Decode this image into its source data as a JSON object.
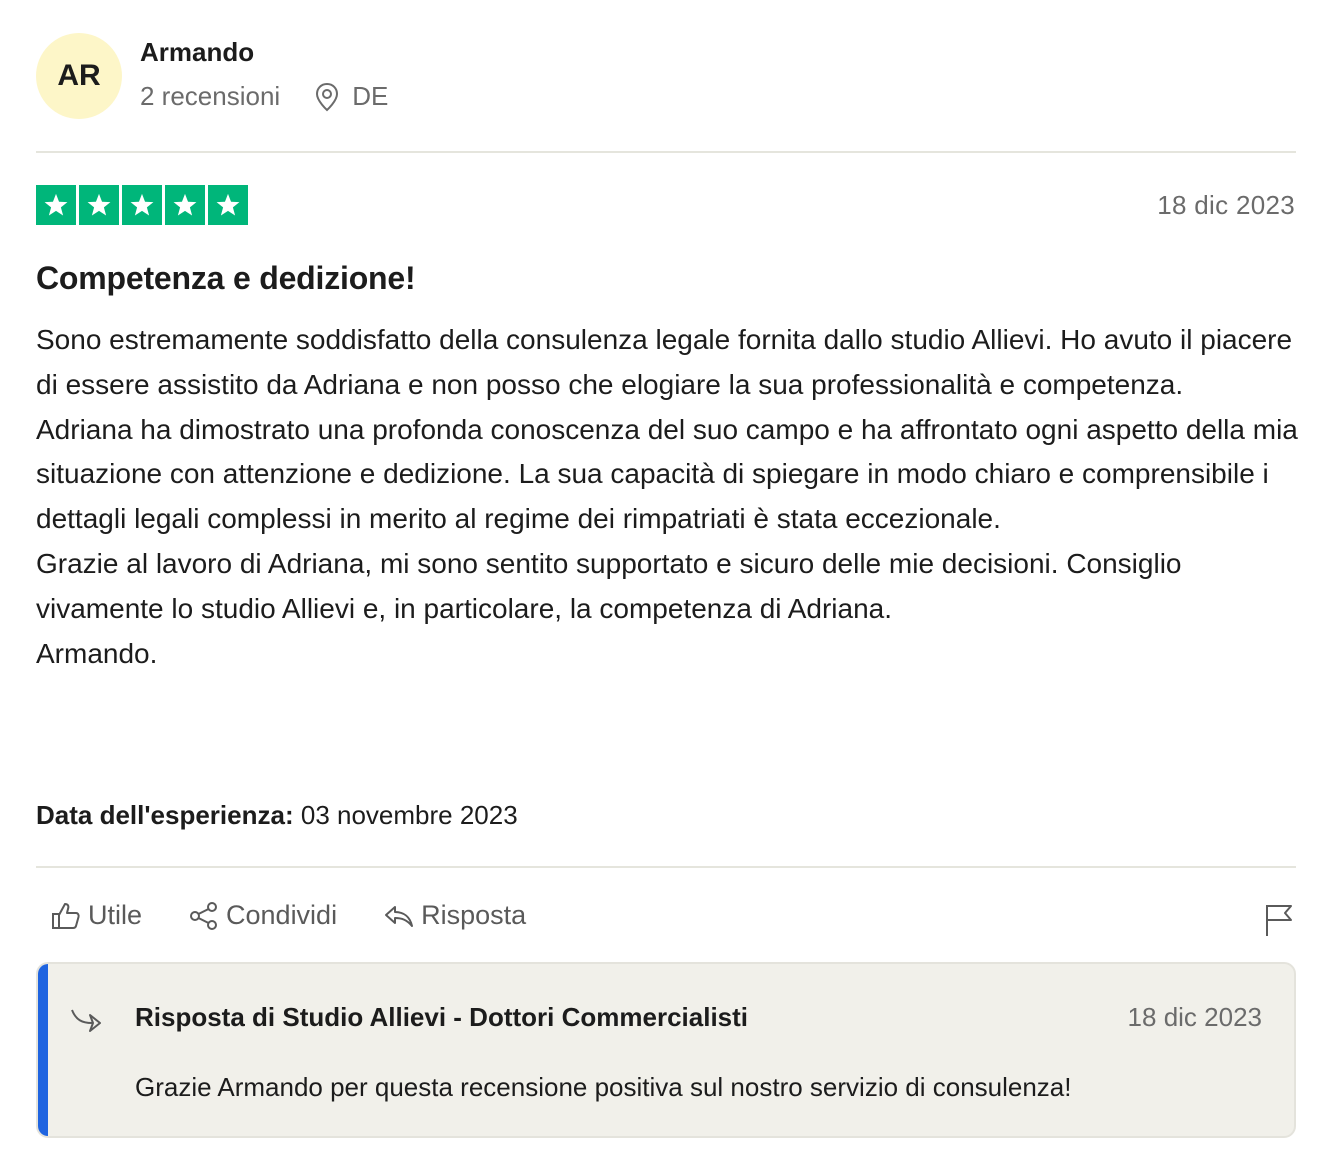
{
  "consumer": {
    "initials": "AR",
    "name": "Armando",
    "reviews_count": "2 recensioni",
    "country": "DE"
  },
  "review": {
    "rating": 5,
    "rating_max": 5,
    "date": "18 dic 2023",
    "title": "Competenza e dedizione!",
    "body": [
      "Sono estremamente soddisfatto della consulenza legale fornita dallo studio Allievi. Ho avuto il piacere di essere assistito da Adriana e non posso che elogiare la sua professionalità e competenza.",
      "Adriana ha dimostrato una profonda conoscenza del suo campo e ha affrontato ogni aspetto della mia situazione con attenzione e dedizione. La sua capacità di spiegare in modo chiaro e comprensibile i dettagli legali complessi in merito al regime dei rimpatriati è stata eccezionale.",
      "Grazie al lavoro di Adriana, mi sono sentito supportato e sicuro delle mie decisioni. Consiglio vivamente lo studio Allievi e, in particolare, la competenza di Adriana.",
      "Armando."
    ],
    "experience_label": "Data dell'esperienza:",
    "experience_date": "03 novembre 2023"
  },
  "actions": {
    "useful": "Utile",
    "share": "Condividi",
    "reply": "Risposta"
  },
  "reply": {
    "title": "Risposta di Studio Allievi - Dottori Commercialisti",
    "date": "18 dic 2023",
    "text": "Grazie Armando per questa recensione positiva sul nostro servizio di consulenza!"
  },
  "colors": {
    "star_green": "#00b67a",
    "avatar_bg": "#fdf6c8",
    "reply_accent": "#1f64e0",
    "reply_bg": "#f1f0ea"
  },
  "icons": [
    "location-pin-icon",
    "star-icon",
    "thumbs-up-icon",
    "share-icon",
    "reply-icon",
    "flag-icon",
    "reply-arrow-icon"
  ]
}
